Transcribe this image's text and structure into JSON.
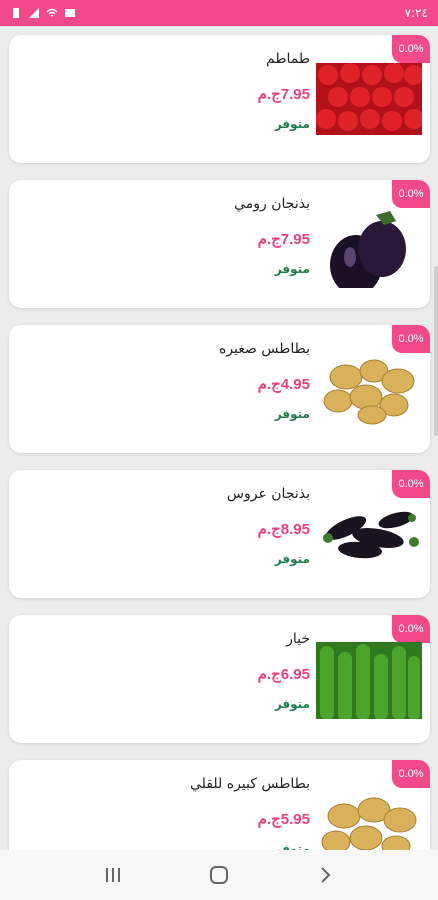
{
  "status_bar": {
    "time": "٧:٢٤"
  },
  "products": [
    {
      "name": "طماطم",
      "price": "7.95ج.م",
      "stock": "متوفر",
      "discount": "0.0%",
      "image": "tomatoes"
    },
    {
      "name": "بذنجان رومي",
      "price": "7.95ج.م",
      "stock": "متوفر",
      "discount": "0.0%",
      "image": "eggplant-roman"
    },
    {
      "name": "بطاطس صغيره",
      "price": "4.95ج.م",
      "stock": "متوفر",
      "discount": "0.0%",
      "image": "small-potatoes"
    },
    {
      "name": "بذنجان عروس",
      "price": "8.95ج.م",
      "stock": "متوفر",
      "discount": "0.0%",
      "image": "baby-eggplant"
    },
    {
      "name": "خيار",
      "price": "6.95ج.م",
      "stock": "متوفر",
      "discount": "0.0%",
      "image": "cucumbers"
    },
    {
      "name": "بطاطس كبيره للقلي",
      "price": "5.95ج.م",
      "stock": "متوفر",
      "discount": "0.0%",
      "image": "large-potatoes"
    }
  ],
  "nav_bar": {
    "recents": "recents-icon",
    "home": "home-icon",
    "back": "back-icon"
  }
}
